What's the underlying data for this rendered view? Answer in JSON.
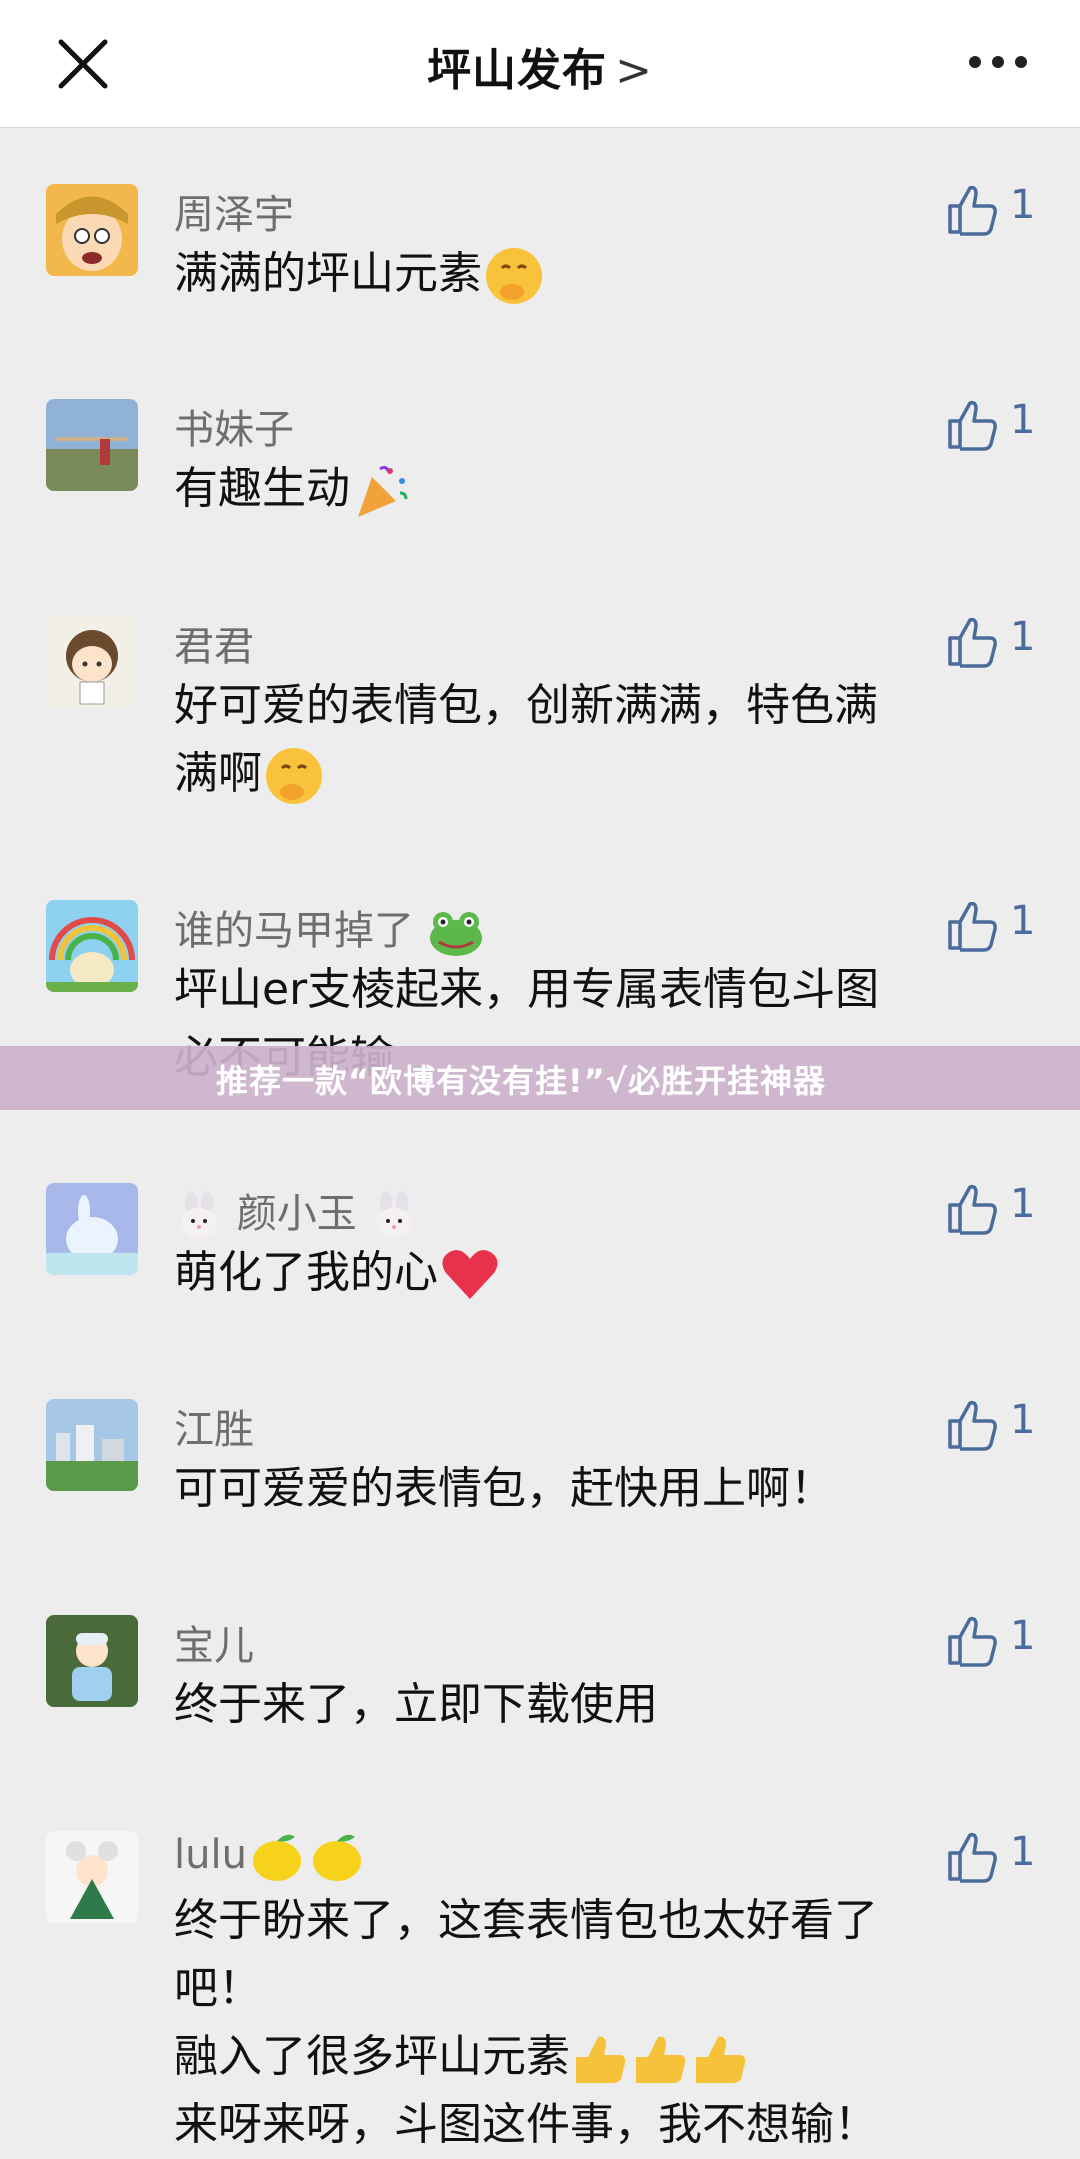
{
  "header": {
    "title": "坪山发布",
    "chevron": ">"
  },
  "icons": {
    "close": "close-icon",
    "more": "more-icon",
    "like": "thumbs-up-icon"
  },
  "colors": {
    "like_blue": "#4b6b9c",
    "banner_bg": "#cdb2cd"
  },
  "comments": [
    {
      "name": "周泽宇",
      "text": "满满的坪山元素",
      "likes": "1"
    },
    {
      "name": "书妹子",
      "text": "有趣生动",
      "likes": "1"
    },
    {
      "name": "君君",
      "text": "好可爱的表情包，创新满满，特色满\n满啊",
      "likes": "1"
    },
    {
      "name": "谁的马甲掉了",
      "text": "坪山er支棱起来，用专属表情包斗图\n必不可能输",
      "likes": "1"
    },
    {
      "name": "颜小玉",
      "text": "萌化了我的心",
      "likes": "1"
    },
    {
      "name": "江胜",
      "text": "可可爱爱的表情包，赶快用上啊！",
      "likes": "1"
    },
    {
      "name": "宝儿",
      "text": "终于来了，立即下载使用",
      "likes": "1"
    },
    {
      "name": "lulu",
      "text": "终于盼来了，这套表情包也太好看了\n吧！\n融入了很多坪山元素",
      "text2": "来呀来呀，斗图这件事，我不想输！",
      "likes": "1"
    }
  ],
  "banner": {
    "text": "推荐一款“欧博有没有挂!”√必胜开挂神器"
  }
}
